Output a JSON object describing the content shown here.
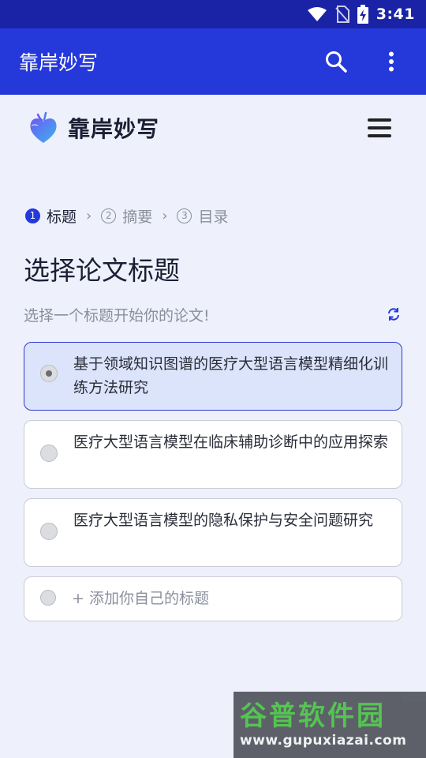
{
  "status_bar": {
    "time": "3:41",
    "icons": [
      "wifi-icon",
      "no-sim-icon",
      "battery-charging-icon"
    ]
  },
  "app_bar": {
    "title": "靠岸妙写",
    "actions": [
      "search-icon",
      "more-vertical-icon"
    ]
  },
  "brand": {
    "name": "靠岸妙写",
    "logo_icon": "heart-logo-icon",
    "menu_icon": "hamburger-menu-icon"
  },
  "stepper": {
    "steps": [
      {
        "num": "1",
        "label": "标题",
        "active": true
      },
      {
        "num": "2",
        "label": "摘要",
        "active": false
      },
      {
        "num": "3",
        "label": "目录",
        "active": false
      }
    ]
  },
  "page": {
    "title": "选择论文标题",
    "subtitle": "选择一个标题开始你的论文!",
    "refresh_icon": "refresh-icon"
  },
  "options": [
    {
      "text": "基于领域知识图谱的医疗大型语言模型精细化训练方法研究",
      "selected": true
    },
    {
      "text": "医疗大型语言模型在临床辅助诊断中的应用探索",
      "selected": false
    },
    {
      "text": "医疗大型语言模型的隐私保护与安全问题研究",
      "selected": false
    }
  ],
  "add_option": {
    "text": "+ 添加你自己的标题"
  },
  "watermark": {
    "title": "谷普软件园",
    "url": "www.gupuxiazai.com"
  },
  "colors": {
    "status_bar": "#1a23a6",
    "app_bar": "#2538d9",
    "background": "#eef1fb",
    "selected_option": "#dce4fb",
    "selected_border": "#2d3ad0"
  }
}
